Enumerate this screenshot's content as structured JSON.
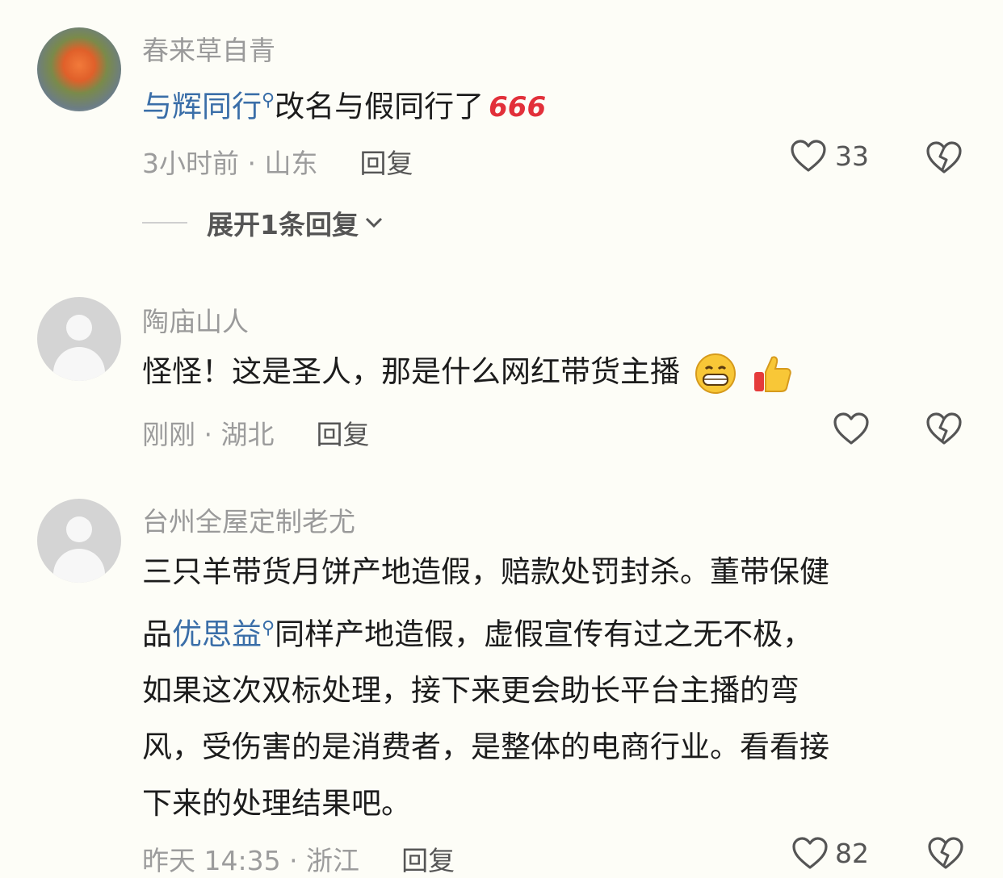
{
  "comments": [
    {
      "username": "春来草自青",
      "content_link": "与辉同行",
      "content_text": "改名与假同行了",
      "badge": "666",
      "time_location": "3小时前 · 山东",
      "reply_label": "回复",
      "like_count": "33",
      "expand_label": "展开1条回复"
    },
    {
      "username": "陶庙山人",
      "content_text": "怪怪！这是圣人，那是什么网红带货主播",
      "time_location": "刚刚 · 湖北",
      "reply_label": "回复"
    },
    {
      "username": "台州全屋定制老尤",
      "content_line1": "三只羊带货月饼产地造假，赔款处罚封杀。董带保健",
      "content_line2_pre": "品",
      "content_line2_link": "优思益",
      "content_line2_post": "同样产地造假，虚假宣传有过之无不极，",
      "content_line3": "如果这次双标处理，接下来更会助长平台主播的弯",
      "content_line4": "风，受伤害的是消费者，是整体的电商行业。看看接",
      "content_line5": "下来的处理结果吧。",
      "time_location": "昨天 14:35 · 浙江",
      "reply_label": "回复",
      "like_count": "82"
    }
  ],
  "icons": {
    "heart": "heart-icon",
    "dislike": "broken-heart-icon",
    "search": "search-icon",
    "chevron": "chevron-down-icon"
  },
  "colors": {
    "background": "#fdfdf7",
    "link": "#3a6ea8",
    "meta": "#9c9c9c",
    "badge": "#e2303a"
  }
}
